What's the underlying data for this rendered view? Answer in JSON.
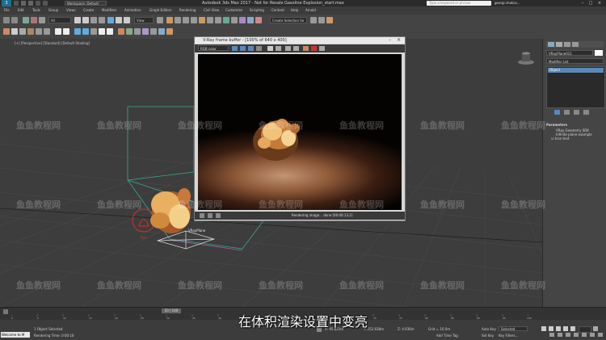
{
  "window": {
    "app_label": "3",
    "workspace": "Workspace: Default",
    "title": "Autodesk 3ds Max 2017 - Not for Resale   Gasoline Explosion_start.max",
    "search_placeholder": "Type a keyword or phrase",
    "user": "georgi.shakov..."
  },
  "menu": [
    "File",
    "Edit",
    "Tools",
    "Group",
    "Views",
    "Create",
    "Modifiers",
    "Animation",
    "Graph Editors",
    "Rendering",
    "Civil View",
    "Customize",
    "Scripting",
    "Content",
    "Help",
    "Arnold"
  ],
  "toolbar": {
    "filter": "All",
    "view": "View",
    "selection_set": "Create Selection Se"
  },
  "viewport": {
    "label": "[+] [Perspective] [Standard] [Default Shading]",
    "gizmo_label": "VRayPlane",
    "fire_label": "Fire"
  },
  "vfb": {
    "title": "V-Ray frame buffer - [100% of 640 x 400]",
    "channel": "RGB color",
    "status": "Rendering image... done [00:00:13.2]"
  },
  "command_panel": {
    "object_name": "VRayPlane011",
    "modifier_list": "Modifier List",
    "selected_modifier": "Object",
    "params_header": "Parameters",
    "params_lines": [
      "VRay Geometry SDK",
      "Infinite plane example",
      "Icon text"
    ]
  },
  "timeline": {
    "frame": "20 / 100",
    "ticks": [
      "0",
      "5",
      "10",
      "15",
      "20",
      "25",
      "30",
      "35",
      "40",
      "45",
      "50",
      "55",
      "60",
      "65",
      "70",
      "75",
      "80",
      "85",
      "90",
      "95",
      "100"
    ]
  },
  "status": {
    "script": "Welcome to M",
    "selection": "1 Object Selected",
    "render_time": "Rendering Time: 0:00:16",
    "x": "X: 95.823m",
    "y": "Y: 252.638m",
    "z": "Z: 4.936m",
    "grid": "Grid = 10.0m",
    "add_time_tag": "Add Time Tag",
    "auto_key": "Auto Key",
    "selected": "Selected",
    "set_key": "Set Key",
    "key_filters": "Key Filters..."
  },
  "subtitle": "在体积渲染设置中变亮",
  "watermark": "鱼鱼教程网",
  "colors": {
    "accent": "#5a88b8",
    "fire": "#e8b060",
    "gizmo_red": "#c03030"
  }
}
